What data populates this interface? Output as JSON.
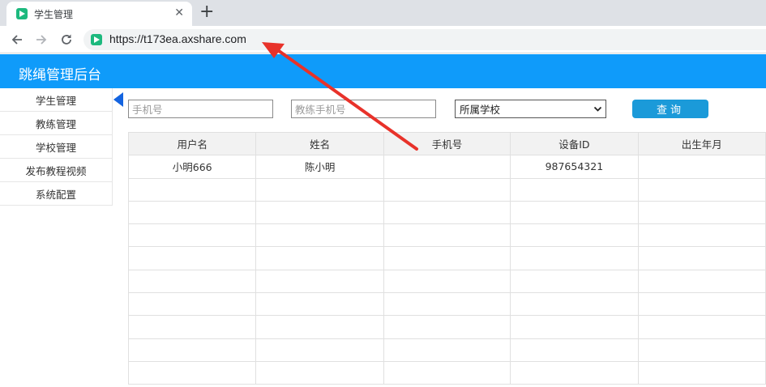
{
  "browser": {
    "tab_title": "学生管理",
    "tab_close": "✕",
    "new_tab": "+",
    "url": "https://t173ea.axshare.com"
  },
  "app": {
    "title": "跳绳管理后台"
  },
  "sidebar": {
    "items": [
      {
        "label": "学生管理",
        "active": true
      },
      {
        "label": "教练管理"
      },
      {
        "label": "学校管理"
      },
      {
        "label": "发布教程视频"
      },
      {
        "label": "系统配置"
      }
    ]
  },
  "filters": {
    "phone_placeholder": "手机号",
    "coach_phone_placeholder": "教练手机号",
    "school_select": "所属学校",
    "query_label": "查询"
  },
  "table": {
    "headers": [
      "用户名",
      "姓名",
      "手机号",
      "设备ID",
      "出生年月"
    ],
    "rows": [
      [
        "小明666",
        "陈小明",
        "",
        "987654321",
        ""
      ]
    ]
  },
  "colors": {
    "header_bg": "#0f9bfa",
    "button_bg": "#1b9ad9",
    "active_marker": "#1464e0",
    "annotation_arrow": "#e8322a"
  }
}
